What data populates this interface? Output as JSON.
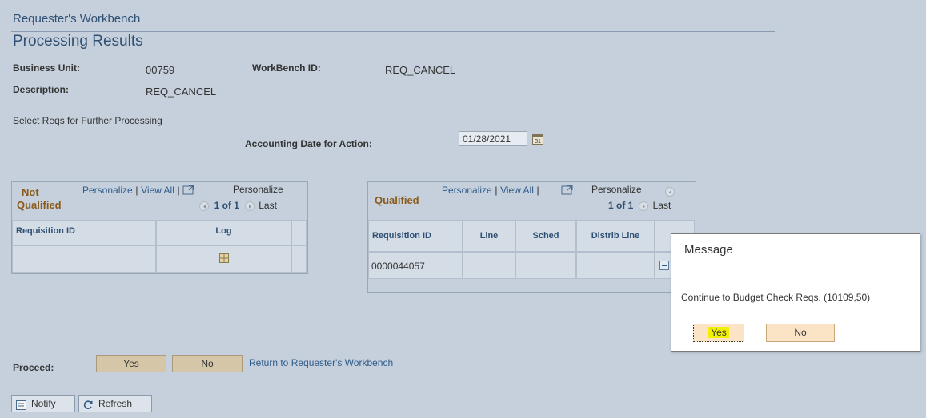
{
  "header": {
    "breadcrumb": "Requester's Workbench",
    "title": "Processing Results"
  },
  "info": {
    "business_unit_label": "Business Unit:",
    "business_unit_value": "00759",
    "workbench_id_label": "WorkBench ID:",
    "workbench_id_value": "REQ_CANCEL",
    "description_label": "Description:",
    "description_value": "REQ_CANCEL",
    "select_text": "Select Reqs for Further Processing",
    "acct_date_label": "Accounting Date for Action:",
    "acct_date_value": "01/28/2021"
  },
  "not_qualified": {
    "title_line1": "Not",
    "title_line2": "Qualified",
    "personalize": "Personalize",
    "view_all": "View All",
    "separator": "|",
    "personalize2": "Personalize",
    "pager": "1 of 1",
    "last": "Last",
    "columns": [
      "Requisition ID",
      "Log"
    ]
  },
  "qualified": {
    "title": "Qualified",
    "personalize": "Personalize",
    "view_all": "View All",
    "separator": "|",
    "personalize2": "Personalize",
    "pager": "1 of 1",
    "last": "Last",
    "columns": [
      "Requisition ID",
      "Line",
      "Sched",
      "Distrib Line"
    ],
    "rows": [
      {
        "requisition_id": "0000044057",
        "line": "",
        "sched": "",
        "distrib_line": ""
      }
    ]
  },
  "proceed": {
    "label": "Proceed:",
    "yes": "Yes",
    "no": "No",
    "return_link": "Return to Requester's Workbench"
  },
  "toolbar": {
    "notify": "Notify",
    "refresh": "Refresh"
  },
  "dialog": {
    "title": "Message",
    "message": "Continue to Budget Check Reqs. (10109,50)",
    "yes": "Yes",
    "no": "No"
  },
  "colors": {
    "page_bg": "#c5d0dc",
    "title_blue": "#2f4f73",
    "grid_title_brown": "#8a5a1a",
    "button_tan": "#d6c6a8",
    "dialog_button": "#fbe3c6",
    "highlight_yellow": "#f0f000"
  },
  "icons": [
    "calendar-icon",
    "expand-grid-icon",
    "nav-prev-icon",
    "nav-next-icon",
    "log-icon",
    "collapse-icon",
    "notify-icon",
    "refresh-icon"
  ]
}
